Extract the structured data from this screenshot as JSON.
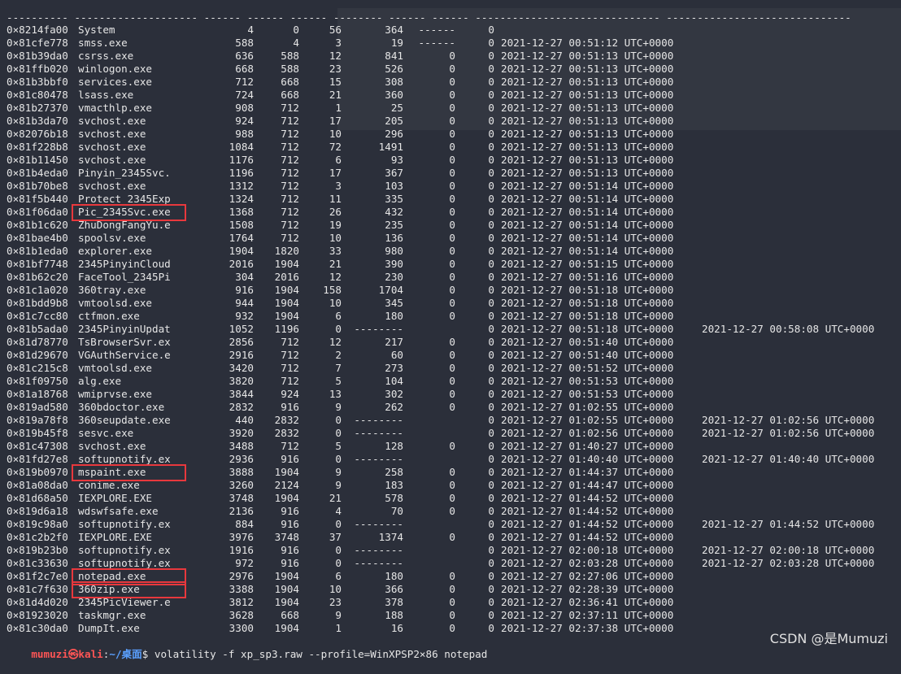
{
  "separator": "---------- -------------------- ------ ------ ------ -------- ------ ------ ------------------------------ ------------------------------",
  "rows": [
    {
      "off": "0×8214fa00",
      "name": "System",
      "pid": "4",
      "ppid": "0",
      "thds": "56",
      "hnds": "364",
      "sess": "------",
      "wow": "0",
      "start": "",
      "exit": ""
    },
    {
      "off": "0×81cfe778",
      "name": "smss.exe",
      "pid": "588",
      "ppid": "4",
      "thds": "3",
      "hnds": "19",
      "sess": "------",
      "wow": "0",
      "start": "2021-12-27 00:51:12 UTC+0000",
      "exit": ""
    },
    {
      "off": "0×81b39da0",
      "name": "csrss.exe",
      "pid": "636",
      "ppid": "588",
      "thds": "12",
      "hnds": "841",
      "sess": "0",
      "wow": "0",
      "start": "2021-12-27 00:51:13 UTC+0000",
      "exit": ""
    },
    {
      "off": "0×81ffb020",
      "name": "winlogon.exe",
      "pid": "668",
      "ppid": "588",
      "thds": "23",
      "hnds": "526",
      "sess": "0",
      "wow": "0",
      "start": "2021-12-27 00:51:13 UTC+0000",
      "exit": ""
    },
    {
      "off": "0×81b3bbf0",
      "name": "services.exe",
      "pid": "712",
      "ppid": "668",
      "thds": "15",
      "hnds": "308",
      "sess": "0",
      "wow": "0",
      "start": "2021-12-27 00:51:13 UTC+0000",
      "exit": ""
    },
    {
      "off": "0×81c80478",
      "name": "lsass.exe",
      "pid": "724",
      "ppid": "668",
      "thds": "21",
      "hnds": "360",
      "sess": "0",
      "wow": "0",
      "start": "2021-12-27 00:51:13 UTC+0000",
      "exit": ""
    },
    {
      "off": "0×81b27370",
      "name": "vmacthlp.exe",
      "pid": "908",
      "ppid": "712",
      "thds": "1",
      "hnds": "25",
      "sess": "0",
      "wow": "0",
      "start": "2021-12-27 00:51:13 UTC+0000",
      "exit": ""
    },
    {
      "off": "0×81b3da70",
      "name": "svchost.exe",
      "pid": "924",
      "ppid": "712",
      "thds": "17",
      "hnds": "205",
      "sess": "0",
      "wow": "0",
      "start": "2021-12-27 00:51:13 UTC+0000",
      "exit": ""
    },
    {
      "off": "0×82076b18",
      "name": "svchost.exe",
      "pid": "988",
      "ppid": "712",
      "thds": "10",
      "hnds": "296",
      "sess": "0",
      "wow": "0",
      "start": "2021-12-27 00:51:13 UTC+0000",
      "exit": ""
    },
    {
      "off": "0×81f228b8",
      "name": "svchost.exe",
      "pid": "1084",
      "ppid": "712",
      "thds": "72",
      "hnds": "1491",
      "sess": "0",
      "wow": "0",
      "start": "2021-12-27 00:51:13 UTC+0000",
      "exit": ""
    },
    {
      "off": "0×81b11450",
      "name": "svchost.exe",
      "pid": "1176",
      "ppid": "712",
      "thds": "6",
      "hnds": "93",
      "sess": "0",
      "wow": "0",
      "start": "2021-12-27 00:51:13 UTC+0000",
      "exit": ""
    },
    {
      "off": "0×81b4eda0",
      "name": "Pinyin_2345Svc.",
      "pid": "1196",
      "ppid": "712",
      "thds": "17",
      "hnds": "367",
      "sess": "0",
      "wow": "0",
      "start": "2021-12-27 00:51:13 UTC+0000",
      "exit": ""
    },
    {
      "off": "0×81b70be8",
      "name": "svchost.exe",
      "pid": "1312",
      "ppid": "712",
      "thds": "3",
      "hnds": "103",
      "sess": "0",
      "wow": "0",
      "start": "2021-12-27 00:51:14 UTC+0000",
      "exit": ""
    },
    {
      "off": "0×81f5b440",
      "name": "Protect_2345Exp",
      "pid": "1324",
      "ppid": "712",
      "thds": "11",
      "hnds": "335",
      "sess": "0",
      "wow": "0",
      "start": "2021-12-27 00:51:14 UTC+0000",
      "exit": ""
    },
    {
      "off": "0×81f06da0",
      "name": "Pic_2345Svc.exe",
      "pid": "1368",
      "ppid": "712",
      "thds": "26",
      "hnds": "432",
      "sess": "0",
      "wow": "0",
      "start": "2021-12-27 00:51:14 UTC+0000",
      "exit": ""
    },
    {
      "off": "0×81b1c620",
      "name": "ZhuDongFangYu.e",
      "pid": "1508",
      "ppid": "712",
      "thds": "19",
      "hnds": "235",
      "sess": "0",
      "wow": "0",
      "start": "2021-12-27 00:51:14 UTC+0000",
      "exit": ""
    },
    {
      "off": "0×81bae4b0",
      "name": "spoolsv.exe",
      "pid": "1764",
      "ppid": "712",
      "thds": "10",
      "hnds": "136",
      "sess": "0",
      "wow": "0",
      "start": "2021-12-27 00:51:14 UTC+0000",
      "exit": ""
    },
    {
      "off": "0×81b1eda0",
      "name": "explorer.exe",
      "pid": "1904",
      "ppid": "1820",
      "thds": "33",
      "hnds": "980",
      "sess": "0",
      "wow": "0",
      "start": "2021-12-27 00:51:14 UTC+0000",
      "exit": ""
    },
    {
      "off": "0×81bf7748",
      "name": "2345PinyinCloud",
      "pid": "2016",
      "ppid": "1904",
      "thds": "21",
      "hnds": "390",
      "sess": "0",
      "wow": "0",
      "start": "2021-12-27 00:51:15 UTC+0000",
      "exit": ""
    },
    {
      "off": "0×81b62c20",
      "name": "FaceTool_2345Pi",
      "pid": "304",
      "ppid": "2016",
      "thds": "12",
      "hnds": "230",
      "sess": "0",
      "wow": "0",
      "start": "2021-12-27 00:51:16 UTC+0000",
      "exit": ""
    },
    {
      "off": "0×81c1a020",
      "name": "360tray.exe",
      "pid": "916",
      "ppid": "1904",
      "thds": "158",
      "hnds": "1704",
      "sess": "0",
      "wow": "0",
      "start": "2021-12-27 00:51:18 UTC+0000",
      "exit": ""
    },
    {
      "off": "0×81bdd9b8",
      "name": "vmtoolsd.exe",
      "pid": "944",
      "ppid": "1904",
      "thds": "10",
      "hnds": "345",
      "sess": "0",
      "wow": "0",
      "start": "2021-12-27 00:51:18 UTC+0000",
      "exit": ""
    },
    {
      "off": "0×81c7cc80",
      "name": "ctfmon.exe",
      "pid": "932",
      "ppid": "1904",
      "thds": "6",
      "hnds": "180",
      "sess": "0",
      "wow": "0",
      "start": "2021-12-27 00:51:18 UTC+0000",
      "exit": ""
    },
    {
      "off": "0×81b5ada0",
      "name": "2345PinyinUpdat",
      "pid": "1052",
      "ppid": "1196",
      "thds": "0",
      "hnds": "--------",
      "sess": "",
      "wow": "0",
      "start": "2021-12-27 00:51:18 UTC+0000",
      "exit": "2021-12-27 00:58:08 UTC+0000"
    },
    {
      "off": "0×81d78770",
      "name": "TsBrowserSvr.ex",
      "pid": "2856",
      "ppid": "712",
      "thds": "12",
      "hnds": "217",
      "sess": "0",
      "wow": "0",
      "start": "2021-12-27 00:51:40 UTC+0000",
      "exit": ""
    },
    {
      "off": "0×81d29670",
      "name": "VGAuthService.e",
      "pid": "2916",
      "ppid": "712",
      "thds": "2",
      "hnds": "60",
      "sess": "0",
      "wow": "0",
      "start": "2021-12-27 00:51:40 UTC+0000",
      "exit": ""
    },
    {
      "off": "0×81c215c8",
      "name": "vmtoolsd.exe",
      "pid": "3420",
      "ppid": "712",
      "thds": "7",
      "hnds": "273",
      "sess": "0",
      "wow": "0",
      "start": "2021-12-27 00:51:52 UTC+0000",
      "exit": ""
    },
    {
      "off": "0×81f09750",
      "name": "alg.exe",
      "pid": "3820",
      "ppid": "712",
      "thds": "5",
      "hnds": "104",
      "sess": "0",
      "wow": "0",
      "start": "2021-12-27 00:51:53 UTC+0000",
      "exit": ""
    },
    {
      "off": "0×81a18768",
      "name": "wmiprvse.exe",
      "pid": "3844",
      "ppid": "924",
      "thds": "13",
      "hnds": "302",
      "sess": "0",
      "wow": "0",
      "start": "2021-12-27 00:51:53 UTC+0000",
      "exit": ""
    },
    {
      "off": "0×819ad580",
      "name": "360bdoctor.exe",
      "pid": "2832",
      "ppid": "916",
      "thds": "9",
      "hnds": "262",
      "sess": "0",
      "wow": "0",
      "start": "2021-12-27 01:02:55 UTC+0000",
      "exit": ""
    },
    {
      "off": "0×819a78f8",
      "name": "360seupdate.exe",
      "pid": "440",
      "ppid": "2832",
      "thds": "0",
      "hnds": "--------",
      "sess": "",
      "wow": "0",
      "start": "2021-12-27 01:02:55 UTC+0000",
      "exit": "2021-12-27 01:02:56 UTC+0000"
    },
    {
      "off": "0×819b45f8",
      "name": "sesvc.exe",
      "pid": "3920",
      "ppid": "2832",
      "thds": "0",
      "hnds": "--------",
      "sess": "",
      "wow": "0",
      "start": "2021-12-27 01:02:56 UTC+0000",
      "exit": "2021-12-27 01:02:56 UTC+0000"
    },
    {
      "off": "0×81c47308",
      "name": "svchost.exe",
      "pid": "3488",
      "ppid": "712",
      "thds": "5",
      "hnds": "128",
      "sess": "0",
      "wow": "0",
      "start": "2021-12-27 01:40:27 UTC+0000",
      "exit": ""
    },
    {
      "off": "0×81fd27e8",
      "name": "softupnotify.ex",
      "pid": "2936",
      "ppid": "916",
      "thds": "0",
      "hnds": "--------",
      "sess": "",
      "wow": "0",
      "start": "2021-12-27 01:40:40 UTC+0000",
      "exit": "2021-12-27 01:40:40 UTC+0000"
    },
    {
      "off": "0×819b0970",
      "name": "mspaint.exe",
      "pid": "3888",
      "ppid": "1904",
      "thds": "9",
      "hnds": "258",
      "sess": "0",
      "wow": "0",
      "start": "2021-12-27 01:44:37 UTC+0000",
      "exit": ""
    },
    {
      "off": "0×81a08da0",
      "name": "conime.exe",
      "pid": "3260",
      "ppid": "2124",
      "thds": "9",
      "hnds": "183",
      "sess": "0",
      "wow": "0",
      "start": "2021-12-27 01:44:47 UTC+0000",
      "exit": ""
    },
    {
      "off": "0×81d68a50",
      "name": "IEXPLORE.EXE",
      "pid": "3748",
      "ppid": "1904",
      "thds": "21",
      "hnds": "578",
      "sess": "0",
      "wow": "0",
      "start": "2021-12-27 01:44:52 UTC+0000",
      "exit": ""
    },
    {
      "off": "0×819d6a18",
      "name": "wdswfsafe.exe",
      "pid": "2136",
      "ppid": "916",
      "thds": "4",
      "hnds": "70",
      "sess": "0",
      "wow": "0",
      "start": "2021-12-27 01:44:52 UTC+0000",
      "exit": ""
    },
    {
      "off": "0×819c98a0",
      "name": "softupnotify.ex",
      "pid": "884",
      "ppid": "916",
      "thds": "0",
      "hnds": "--------",
      "sess": "",
      "wow": "0",
      "start": "2021-12-27 01:44:52 UTC+0000",
      "exit": "2021-12-27 01:44:52 UTC+0000"
    },
    {
      "off": "0×81c2b2f0",
      "name": "IEXPLORE.EXE",
      "pid": "3976",
      "ppid": "3748",
      "thds": "37",
      "hnds": "1374",
      "sess": "0",
      "wow": "0",
      "start": "2021-12-27 01:44:52 UTC+0000",
      "exit": ""
    },
    {
      "off": "0×819b23b0",
      "name": "softupnotify.ex",
      "pid": "1916",
      "ppid": "916",
      "thds": "0",
      "hnds": "--------",
      "sess": "",
      "wow": "0",
      "start": "2021-12-27 02:00:18 UTC+0000",
      "exit": "2021-12-27 02:00:18 UTC+0000"
    },
    {
      "off": "0×81c33630",
      "name": "softupnotify.ex",
      "pid": "972",
      "ppid": "916",
      "thds": "0",
      "hnds": "--------",
      "sess": "",
      "wow": "0",
      "start": "2021-12-27 02:03:28 UTC+0000",
      "exit": "2021-12-27 02:03:28 UTC+0000"
    },
    {
      "off": "0×81f2c7e0",
      "name": "notepad.exe",
      "pid": "2976",
      "ppid": "1904",
      "thds": "6",
      "hnds": "180",
      "sess": "0",
      "wow": "0",
      "start": "2021-12-27 02:27:06 UTC+0000",
      "exit": ""
    },
    {
      "off": "0×81c7f630",
      "name": "360zip.exe",
      "pid": "3388",
      "ppid": "1904",
      "thds": "10",
      "hnds": "366",
      "sess": "0",
      "wow": "0",
      "start": "2021-12-27 02:28:39 UTC+0000",
      "exit": ""
    },
    {
      "off": "0×81d4d020",
      "name": "2345PicViewer.e",
      "pid": "3812",
      "ppid": "1904",
      "thds": "23",
      "hnds": "378",
      "sess": "0",
      "wow": "0",
      "start": "2021-12-27 02:36:41 UTC+0000",
      "exit": ""
    },
    {
      "off": "0×81923020",
      "name": "taskmgr.exe",
      "pid": "3628",
      "ppid": "668",
      "thds": "9",
      "hnds": "188",
      "sess": "0",
      "wow": "0",
      "start": "2021-12-27 02:37:11 UTC+0000",
      "exit": ""
    },
    {
      "off": "0×81c30da0",
      "name": "DumpIt.exe",
      "pid": "3300",
      "ppid": "1904",
      "thds": "1",
      "hnds": "16",
      "sess": "0",
      "wow": "0",
      "start": "2021-12-27 02:37:38 UTC+0000",
      "exit": ""
    }
  ],
  "highlighted_rows": [
    14,
    34,
    42,
    43
  ],
  "prompt": {
    "user": "mumuzi㉿kali",
    "sep": ":",
    "path": "~/桌面",
    "symbol": "$",
    "command": " volatility -f xp_sp3.raw --profile=WinXPSP2×86 notepad"
  },
  "watermark": "CSDN @是Mumuzi",
  "colors": {
    "background": "#2b2f3a",
    "highlight_box": "#e8383d",
    "prompt_user": "#ff5555",
    "prompt_path": "#5aa0ff"
  }
}
